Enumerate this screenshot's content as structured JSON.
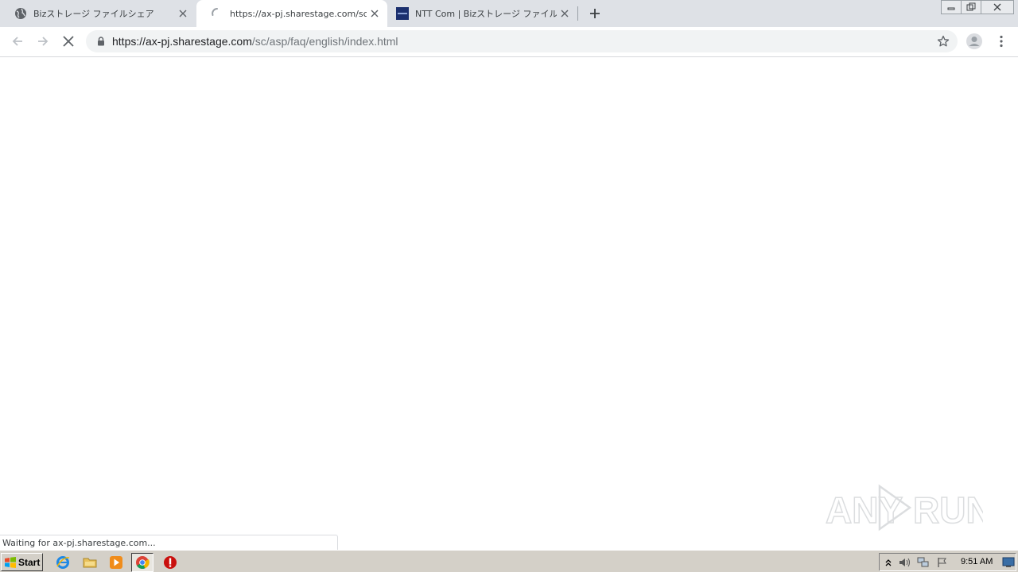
{
  "browser": {
    "tabs": [
      {
        "title": "Bizストレージ ファイルシェア",
        "favicon": "globe-icon",
        "active": false
      },
      {
        "title": "https://ax-pj.sharestage.com/sc/asp",
        "favicon": "loading-spinner-icon",
        "active": true
      },
      {
        "title": "NTT Com | Bizストレージ ファイルシェア |",
        "favicon": "ntt-com-favicon-icon",
        "active": false
      }
    ],
    "address_bar": {
      "host": "https://ax-pj.sharestage.com",
      "path": "/sc/asp/faq/english/index.html"
    },
    "status_text": "Waiting for ax-pj.sharestage.com..."
  },
  "watermark": {
    "text_left": "ANY",
    "text_right": "RUN"
  },
  "taskbar": {
    "start_label": "Start",
    "quick_launch": [
      "internet-explorer-icon",
      "explorer-folder-icon",
      "media-player-icon",
      "chrome-icon",
      "stop-sign-icon"
    ],
    "tray_icons": [
      "show-hidden-icons-icon",
      "volume-icon",
      "network-icon",
      "action-center-flag-icon"
    ],
    "clock": "9:51 AM"
  },
  "colors": {
    "tabstrip": "#dee1e6",
    "omnibox": "#f1f3f4",
    "taskbar": "#d4d0c8",
    "accent_blue": "#1a73e8"
  }
}
